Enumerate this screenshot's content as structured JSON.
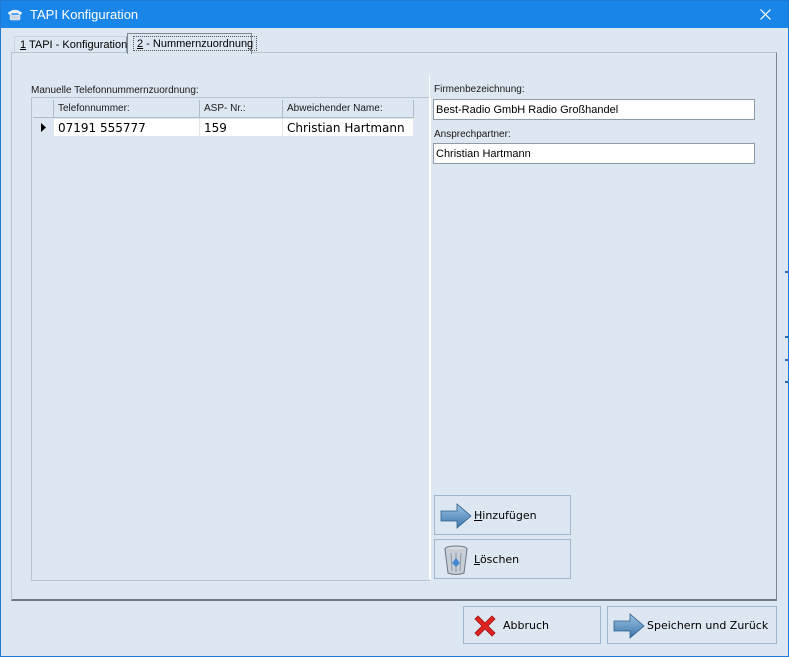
{
  "window": {
    "title": "TAPI Konfiguration"
  },
  "tabs": [
    {
      "accel": "1",
      "label": " TAPI - Konfiguration"
    },
    {
      "accel": "2",
      "label": " - Nummernzuordnung"
    }
  ],
  "grid": {
    "label": "Manuelle Telefonnummernzuordnung:",
    "columns": [
      "Telefonnummer:",
      "ASP- Nr.:",
      "Abweichender Name:"
    ],
    "rows": [
      {
        "telefonnummer": "07191 555777",
        "asp_nr": "159",
        "name": "Christian Hartmann"
      }
    ]
  },
  "firma": {
    "label": "Firmenbezeichnung:",
    "value": "Best-Radio GmbH Radio Großhandel"
  },
  "ansprechpartner": {
    "label": "Ansprechpartner:",
    "value": "Christian Hartmann"
  },
  "buttons": {
    "hinzufuegen": {
      "accel": "H",
      "rest": "inzufügen"
    },
    "loeschen": {
      "accel": "L",
      "rest": "öschen"
    },
    "abbruch": "Abbruch",
    "speichern": "Speichern und Zurück"
  },
  "icons": {
    "title": "phone-icon",
    "close": "close-icon",
    "add": "arrow-right-icon",
    "delete": "recycle-bin-icon",
    "cancel": "red-x-icon",
    "save": "arrow-right-icon"
  },
  "colors": {
    "titlebar": "#1a85e8",
    "background": "#dde7f1",
    "arrow": "#4f86b8",
    "cancel": "#e02424"
  }
}
